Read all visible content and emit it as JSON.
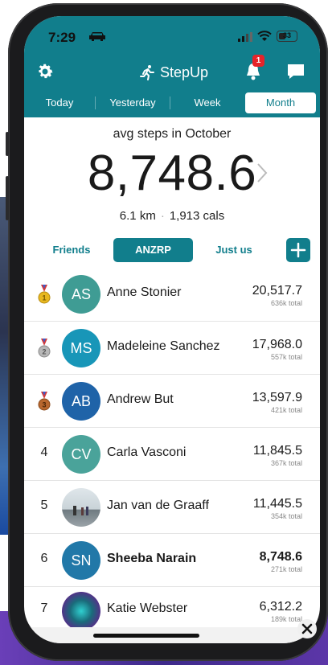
{
  "status": {
    "time": "7:29",
    "battery": "33"
  },
  "header": {
    "app_name": "StepUp",
    "notification_count": "1"
  },
  "tabs": [
    {
      "label": "Today",
      "selected": false
    },
    {
      "label": "Yesterday",
      "selected": false
    },
    {
      "label": "Week",
      "selected": false
    },
    {
      "label": "Month",
      "selected": true
    }
  ],
  "summary": {
    "title": "avg steps in October",
    "value": "8,748.6",
    "distance": "6.1 km",
    "calories": "1,913 cals"
  },
  "groups": [
    {
      "label": "Friends",
      "selected": false
    },
    {
      "label": "ANZRP",
      "selected": true
    },
    {
      "label": "Just us",
      "selected": false
    }
  ],
  "leaderboard": [
    {
      "rank": "",
      "medal": "gold",
      "initials": "AS",
      "avatar_color": "#3f9c94",
      "name": "Anne Stonier",
      "steps": "20,517.7",
      "total": "636k total",
      "highlight": false
    },
    {
      "rank": "",
      "medal": "silver",
      "initials": "MS",
      "avatar_color": "#1896b8",
      "name": "Madeleine Sanchez",
      "steps": "17,968.0",
      "total": "557k total",
      "highlight": false
    },
    {
      "rank": "",
      "medal": "bronze",
      "initials": "AB",
      "avatar_color": "#1f63a8",
      "name": "Andrew But",
      "steps": "13,597.9",
      "total": "421k total",
      "highlight": false
    },
    {
      "rank": "4",
      "medal": "",
      "initials": "CV",
      "avatar_color": "#4aa39a",
      "name": "Carla Vasconi",
      "steps": "11,845.5",
      "total": "367k total",
      "highlight": false
    },
    {
      "rank": "5",
      "medal": "",
      "initials": "",
      "avatar_color": "#8a9aa6",
      "name": "Jan van de Graaff",
      "steps": "11,445.5",
      "total": "354k total",
      "highlight": false
    },
    {
      "rank": "6",
      "medal": "",
      "initials": "SN",
      "avatar_color": "#2178a8",
      "name": "Sheeba Narain",
      "steps": "8,748.6",
      "total": "271k total",
      "highlight": true
    },
    {
      "rank": "7",
      "medal": "",
      "initials": "",
      "avatar_color": "#1a6b7a",
      "name": "Katie Webster",
      "steps": "6,312.2",
      "total": "189k total",
      "highlight": false
    }
  ],
  "colors": {
    "brand": "#117e8c",
    "badge": "#e5242a"
  }
}
